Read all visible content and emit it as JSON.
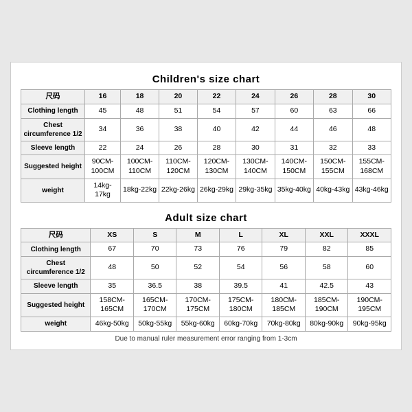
{
  "children_chart": {
    "title": "Children's size chart",
    "columns": [
      "尺码",
      "16",
      "18",
      "20",
      "22",
      "24",
      "26",
      "28",
      "30"
    ],
    "rows": [
      {
        "label": "Clothing length",
        "values": [
          "45",
          "48",
          "51",
          "54",
          "57",
          "60",
          "63",
          "66"
        ]
      },
      {
        "label": "Chest circumference 1/2",
        "values": [
          "34",
          "36",
          "38",
          "40",
          "42",
          "44",
          "46",
          "48"
        ]
      },
      {
        "label": "Sleeve length",
        "values": [
          "22",
          "24",
          "26",
          "28",
          "30",
          "31",
          "32",
          "33"
        ]
      },
      {
        "label": "Suggested height",
        "values": [
          "90CM-100CM",
          "100CM-110CM",
          "110CM-120CM",
          "120CM-130CM",
          "130CM-140CM",
          "140CM-150CM",
          "150CM-155CM",
          "155CM-168CM"
        ]
      },
      {
        "label": "weight",
        "values": [
          "14kg-17kg",
          "18kg-22kg",
          "22kg-26kg",
          "26kg-29kg",
          "29kg-35kg",
          "35kg-40kg",
          "40kg-43kg",
          "43kg-46kg"
        ]
      }
    ]
  },
  "adult_chart": {
    "title": "Adult size chart",
    "columns": [
      "尺码",
      "XS",
      "S",
      "M",
      "L",
      "XL",
      "XXL",
      "XXXL"
    ],
    "rows": [
      {
        "label": "Clothing length",
        "values": [
          "67",
          "70",
          "73",
          "76",
          "79",
          "82",
          "85"
        ]
      },
      {
        "label": "Chest circumference 1/2",
        "values": [
          "48",
          "50",
          "52",
          "54",
          "56",
          "58",
          "60"
        ]
      },
      {
        "label": "Sleeve length",
        "values": [
          "35",
          "36.5",
          "38",
          "39.5",
          "41",
          "42.5",
          "43"
        ]
      },
      {
        "label": "Suggested height",
        "values": [
          "158CM-165CM",
          "165CM-170CM",
          "170CM-175CM",
          "175CM-180CM",
          "180CM-185CM",
          "185CM-190CM",
          "190CM-195CM"
        ]
      },
      {
        "label": "weight",
        "values": [
          "46kg-50kg",
          "50kg-55kg",
          "55kg-60kg",
          "60kg-70kg",
          "70kg-80kg",
          "80kg-90kg",
          "90kg-95kg"
        ]
      }
    ]
  },
  "disclaimer": "Due to manual ruler measurement error ranging from 1-3cm"
}
